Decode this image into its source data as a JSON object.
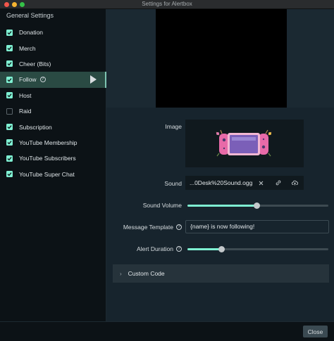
{
  "window": {
    "title": "Settings for Alertbox"
  },
  "sidebar": {
    "title": "General Settings",
    "items": [
      {
        "label": "Donation",
        "checked": true,
        "active": false
      },
      {
        "label": "Merch",
        "checked": true,
        "active": false
      },
      {
        "label": "Cheer (Bits)",
        "checked": true,
        "active": false
      },
      {
        "label": "Follow",
        "checked": true,
        "active": true,
        "help_icon": "question-circle-icon"
      },
      {
        "label": "Host",
        "checked": true,
        "active": false
      },
      {
        "label": "Raid",
        "checked": false,
        "active": false
      },
      {
        "label": "Subscription",
        "checked": true,
        "active": false
      },
      {
        "label": "YouTube Membership",
        "checked": true,
        "active": false
      },
      {
        "label": "YouTube Subscribers",
        "checked": true,
        "active": false
      },
      {
        "label": "YouTube Super Chat",
        "checked": true,
        "active": false
      }
    ]
  },
  "form": {
    "image_label": "Image",
    "sound_label": "Sound",
    "sound_file": "...0Desk%20Sound.ogg",
    "sound_actions": [
      "clear-icon",
      "link-icon",
      "upload-cloud-icon"
    ],
    "sound_volume_label": "Sound Volume",
    "sound_volume": 0.49,
    "message_template_label": "Message Template",
    "message_template_value": "{name} is now following!",
    "alert_duration_label": "Alert Duration",
    "alert_duration": 0.24,
    "custom_code_label": "Custom Code"
  },
  "footer": {
    "close_label": "Close"
  },
  "colors": {
    "accent": "#7ff0d2",
    "active_item_bg": "#2a4a43",
    "panel_bg": "#17242d",
    "sidebar_bg": "#0c1216"
  }
}
